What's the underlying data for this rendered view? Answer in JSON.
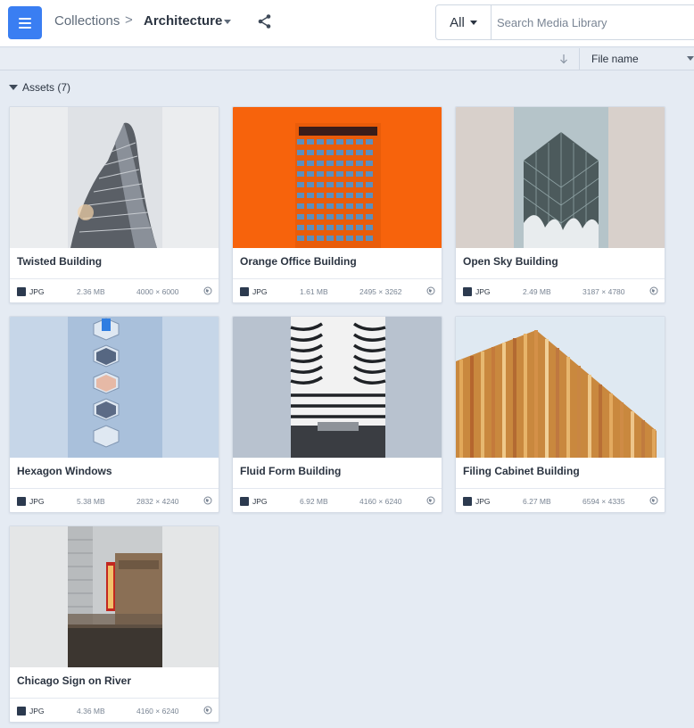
{
  "header": {
    "breadcrumb_root": "Collections",
    "breadcrumb_separator": ">",
    "breadcrumb_current": "Architecture",
    "menu_icon": "hamburger-icon",
    "share_icon": "share-icon"
  },
  "search": {
    "filter_value": "All",
    "placeholder": "Search Media Library"
  },
  "sort": {
    "direction_icon": "arrow-down-icon",
    "field": "File name"
  },
  "section": {
    "label": "Assets (7)"
  },
  "colors": {
    "accent": "#3a7ef2",
    "background": "#e5ebf3"
  },
  "assets": [
    {
      "title": "Twisted Building",
      "type": "JPG",
      "size": "2.36 MB",
      "dimensions": "4000 × 6000"
    },
    {
      "title": "Orange Office Building",
      "type": "JPG",
      "size": "1.61 MB",
      "dimensions": "2495 × 3262"
    },
    {
      "title": "Open Sky Building",
      "type": "JPG",
      "size": "2.49 MB",
      "dimensions": "3187 × 4780"
    },
    {
      "title": "Hexagon Windows",
      "type": "JPG",
      "size": "5.38 MB",
      "dimensions": "2832 × 4240"
    },
    {
      "title": "Fluid Form Building",
      "type": "JPG",
      "size": "6.92 MB",
      "dimensions": "4160 × 6240"
    },
    {
      "title": "Filing Cabinet Building",
      "type": "JPG",
      "size": "6.27 MB",
      "dimensions": "6594 × 4335"
    },
    {
      "title": "Chicago Sign on River",
      "type": "JPG",
      "size": "4.36 MB",
      "dimensions": "4160 × 6240"
    }
  ]
}
